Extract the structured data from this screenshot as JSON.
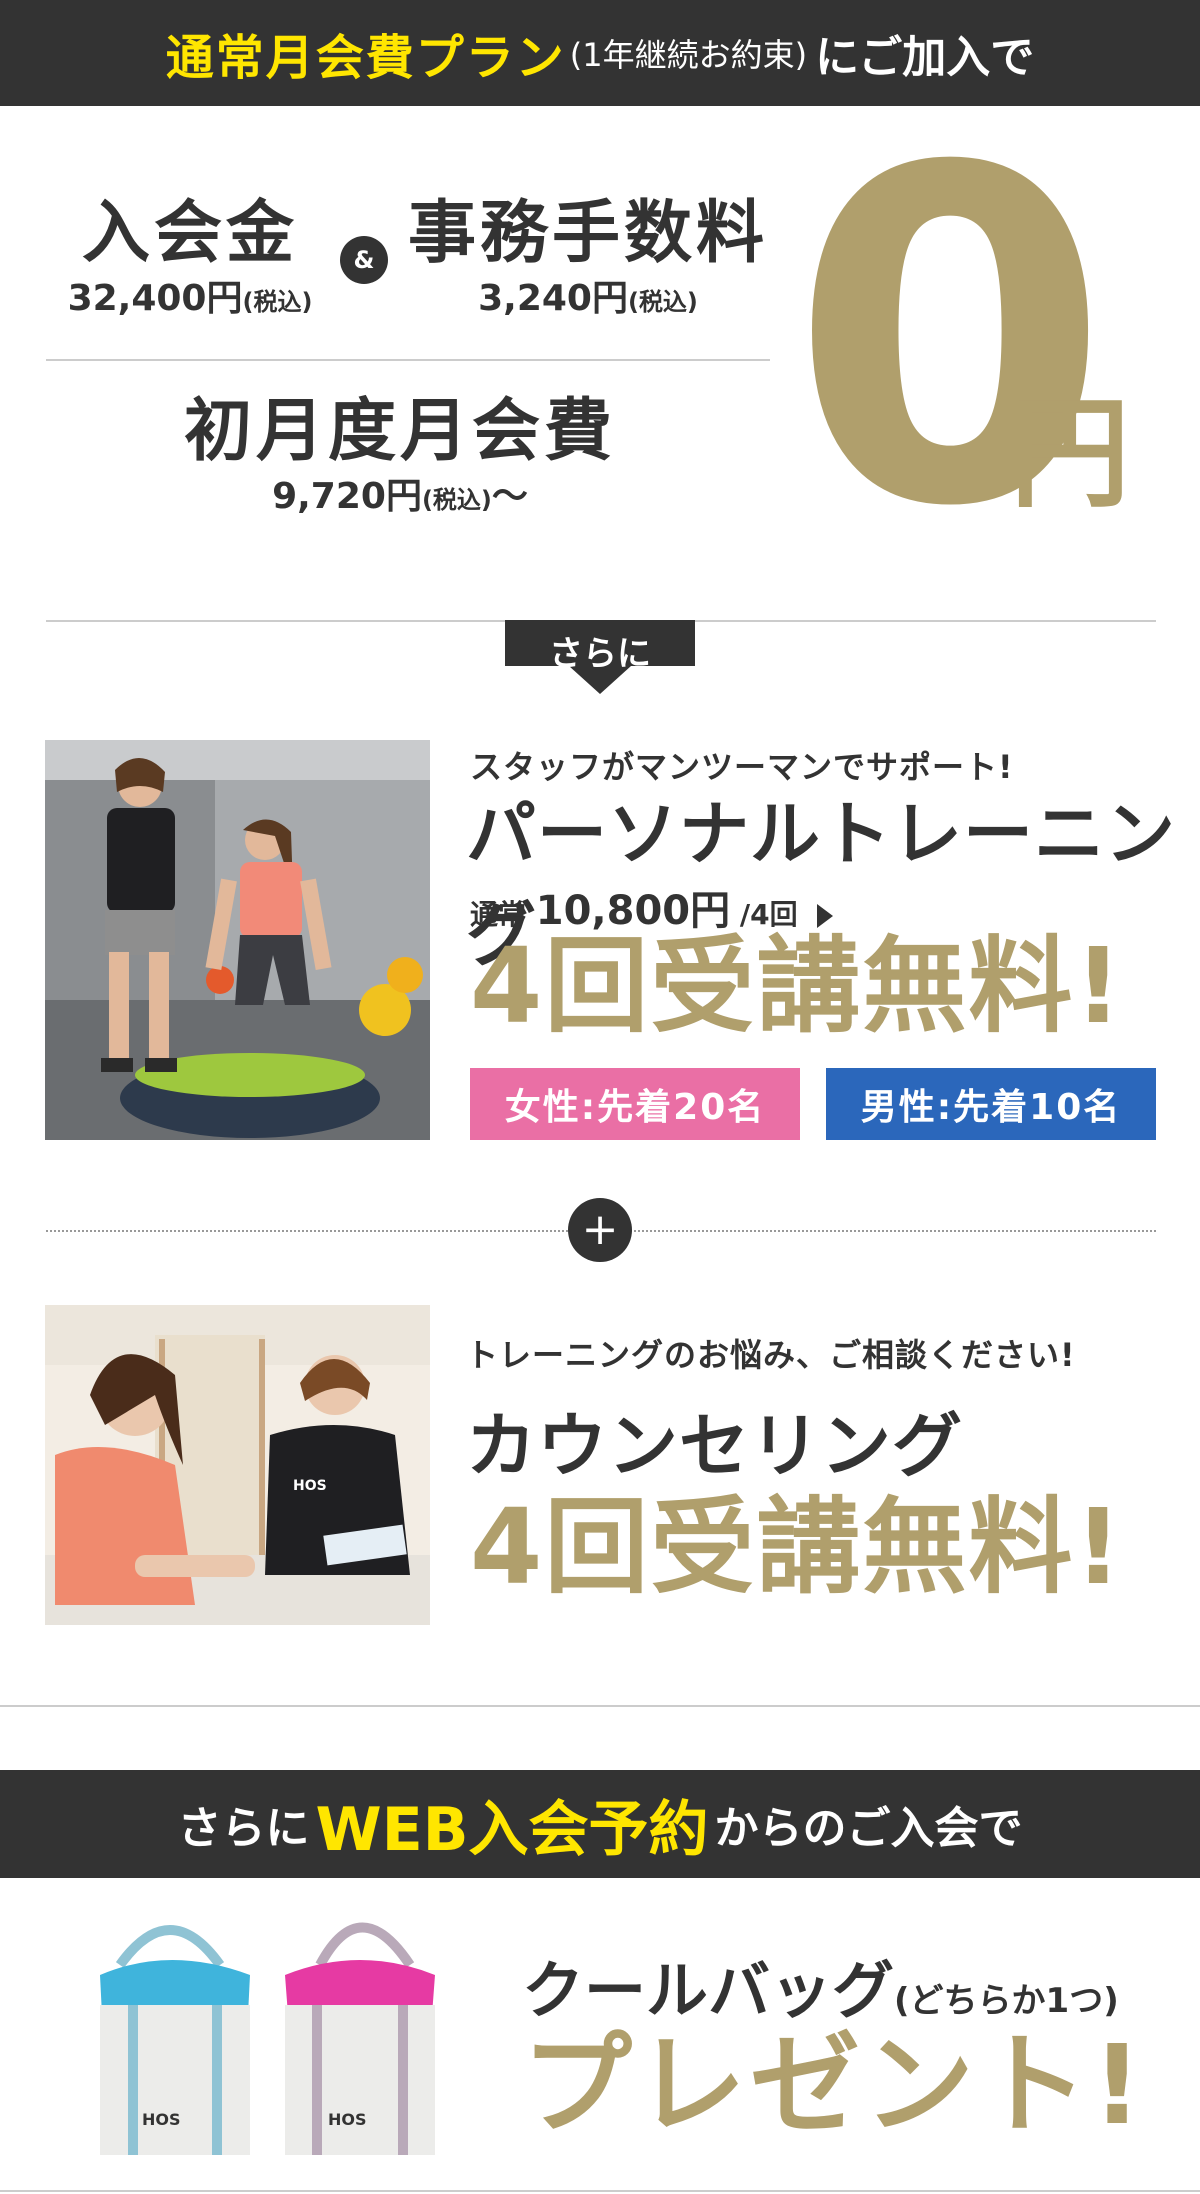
{
  "top_band": {
    "highlight": "通常月会費プラン",
    "note": "(1年継続お約束)",
    "tail": "にご加入で"
  },
  "fees": {
    "entry": {
      "name": "入会金",
      "price": "32,400円",
      "tax": "(税込)"
    },
    "amp": "&",
    "admin": {
      "name": "事務手数料",
      "price": "3,240円",
      "tax": "(税込)"
    },
    "first_month": {
      "name": "初月度月会費",
      "price": "9,720円",
      "tax": "(税込)",
      "suffix": "〜"
    },
    "zero": "0",
    "yen": "円"
  },
  "sarani": "さらに",
  "personal": {
    "catch": "スタッフがマンツーマンでサポート!",
    "title": "パーソナルトレーニング",
    "regular_prefix": "通常",
    "regular_price": "10,800円",
    "regular_suffix": "/4回",
    "free": "4回受講無料!",
    "women": "女性:先着20名",
    "men": "男性:先着10名"
  },
  "plus": "+",
  "counseling": {
    "catch": "トレーニングのお悩み、ご相談ください!",
    "title": "カウンセリング",
    "free": "4回受講無料!"
  },
  "web_band": {
    "pre": "さらに",
    "highlight": "WEB入会予約",
    "post": "からのご入会で"
  },
  "bag": {
    "title": "クールバッグ",
    "note": "(どちらか1つ)",
    "present": "プレゼント!",
    "logo": "HOS"
  },
  "colors": {
    "dark_band": "#333333",
    "yellow": "#ffe600",
    "gold": "#b09f6c",
    "pink": "#ea6fa5",
    "blue": "#2b67bb"
  }
}
